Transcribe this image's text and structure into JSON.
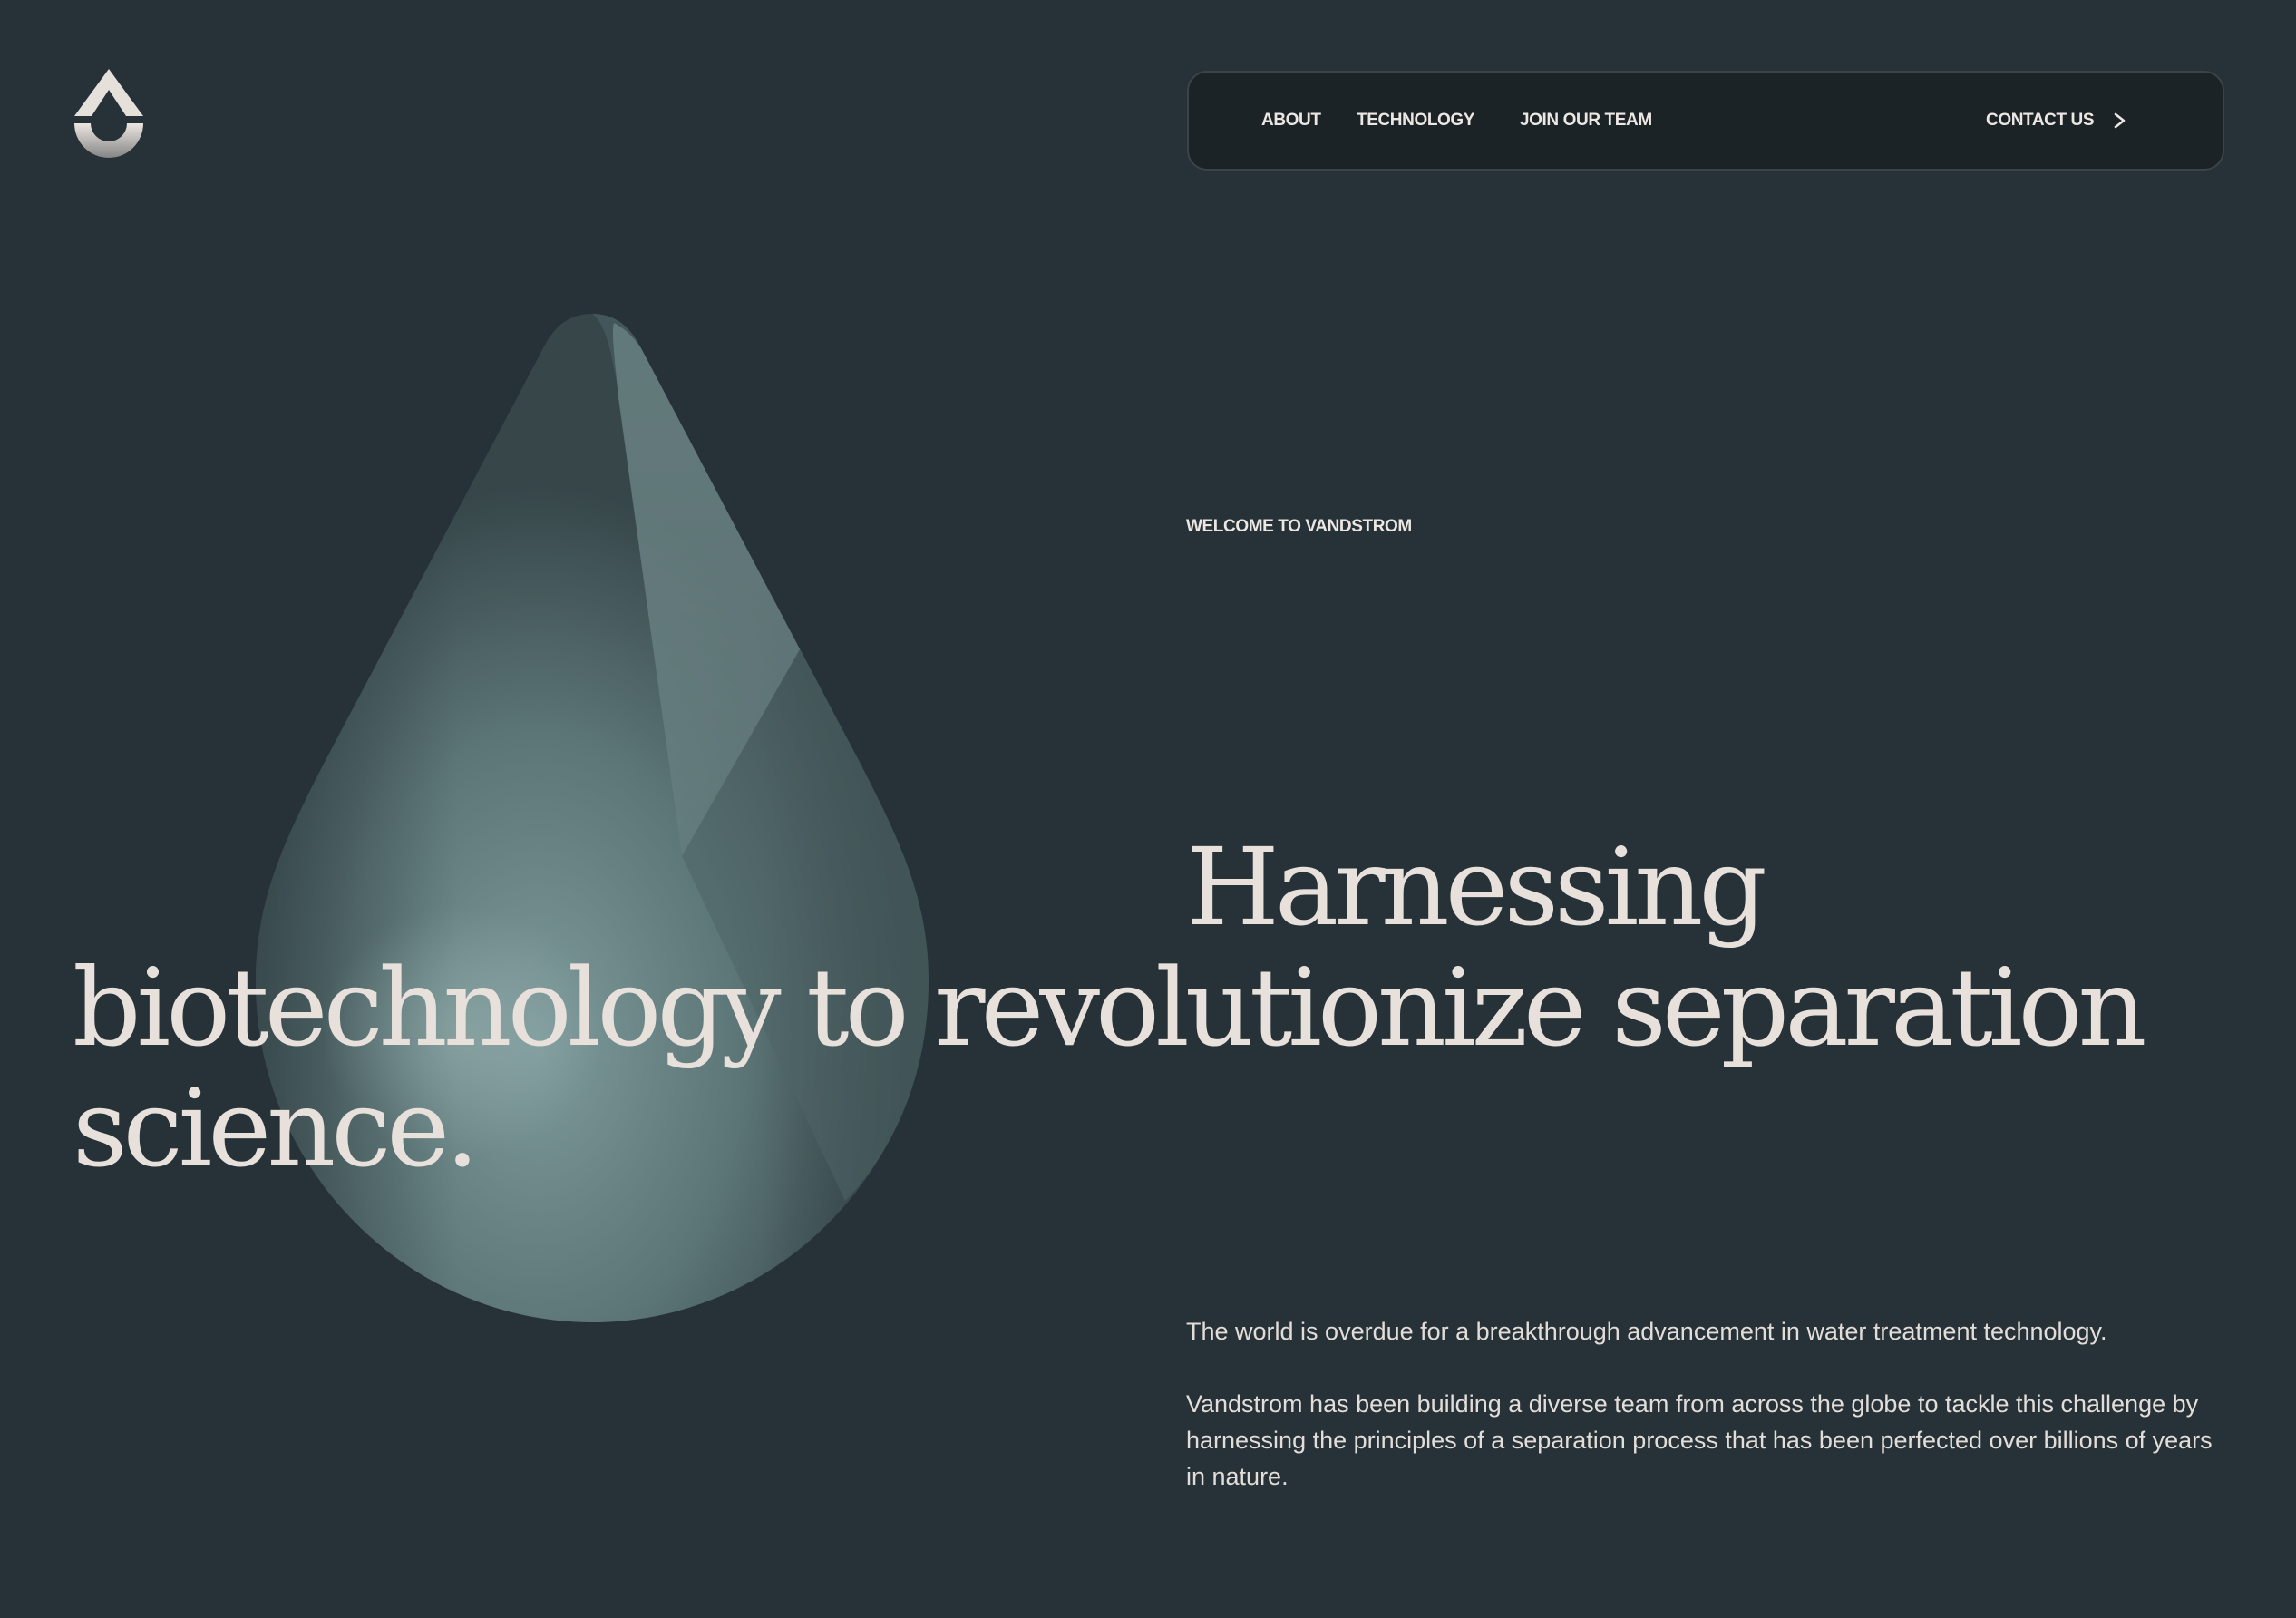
{
  "brand": {
    "logo_icon": "water-drop-logo-icon",
    "colors": {
      "background": "#263237",
      "nav_background": "#1c2326",
      "text": "#e7e0db",
      "drop": "#6f8a8a"
    }
  },
  "nav": {
    "links": [
      {
        "label": "ABOUT"
      },
      {
        "label": "TECHNOLOGY"
      },
      {
        "label": "JOIN OUR TEAM"
      }
    ],
    "contact": {
      "label": "CONTACT US",
      "icon": "chevron-right-icon"
    }
  },
  "hero": {
    "eyebrow": "WELCOME TO VANDSTROM",
    "headline": "Harnessing biotechnology to revolutionize separation science.",
    "paragraphs": [
      "The world is overdue for a breakthrough advancement in water treatment technology.",
      "Vandstrom has been building a diverse team from across the globe to tackle this challenge by harnessing the principles of a separation process that has been perfected over billions of years in nature."
    ]
  }
}
